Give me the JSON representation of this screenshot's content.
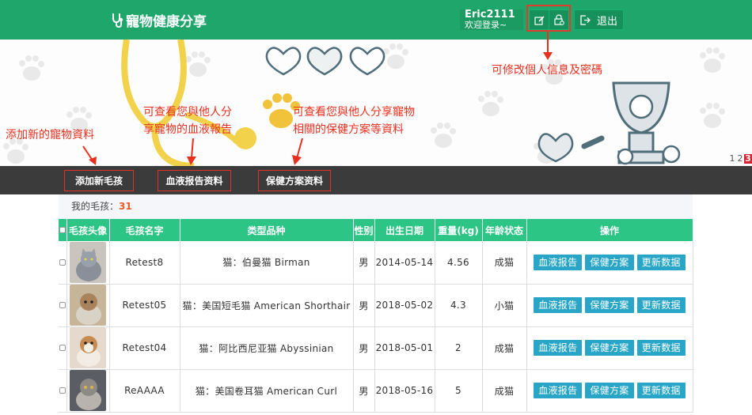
{
  "header": {
    "title": "寵物健康分享",
    "username": "Eric2111",
    "greeting": "欢迎登录~",
    "logout_label": "退出"
  },
  "banner": {
    "note_profile": "可修改個人信息及密碼",
    "note_add": "添加新的寵物資料",
    "note_blood_1": "可查看您與他人分",
    "note_blood_2": "享寵物的血液報告",
    "note_health_1": "可查看您與他人分享寵物",
    "note_health_2": "相關的保健方案等資料",
    "pages": [
      "1",
      "2",
      "3"
    ],
    "active_page": "3"
  },
  "nav": {
    "add_pet": "添加新毛孩",
    "blood_report": "血液报告资料",
    "health_plan": "保健方案资料"
  },
  "pets": {
    "label": "我的毛孩：",
    "count": "31"
  },
  "table": {
    "headers": [
      "毛孩头像",
      "毛孩名字",
      "类型品种",
      "性别",
      "出生日期",
      "重量(kg)",
      "年龄状态",
      "操作"
    ],
    "rows": [
      {
        "name": "Retest8",
        "breed": "猫：伯曼猫 Birman",
        "sex": "男",
        "birth": "2014-05-14",
        "weight": "4.56",
        "age": "成猫"
      },
      {
        "name": "Retest05",
        "breed": "猫：美国短毛猫 American Shorthair",
        "sex": "男",
        "birth": "2018-05-02",
        "weight": "4.3",
        "age": "小猫"
      },
      {
        "name": "Retest04",
        "breed": "猫：阿比西尼亚猫 Abyssinian",
        "sex": "男",
        "birth": "2018-05-01",
        "weight": "2",
        "age": "成猫"
      },
      {
        "name": "ReAAAA",
        "breed": "猫：美国卷耳猫 American Curl",
        "sex": "男",
        "birth": "2018-05-16",
        "weight": "5",
        "age": "成猫"
      }
    ],
    "actions": {
      "blood": "血液报告",
      "health": "保健方案",
      "update": "更新数据"
    }
  },
  "colors": {
    "header_green": "#1ea66b",
    "table_header_green": "#2dc586",
    "action_blue": "#29a6c7",
    "annotation_red": "#e8301f",
    "navbar_dark": "#3b3b3b"
  }
}
